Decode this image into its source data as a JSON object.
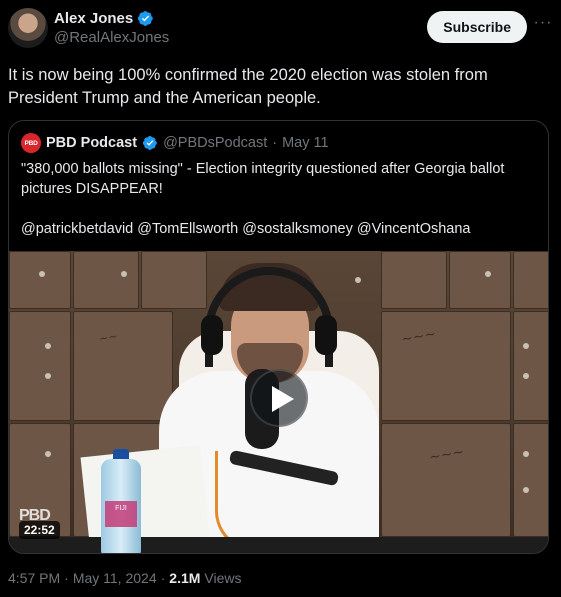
{
  "author": {
    "display_name": "Alex Jones",
    "handle": "@RealAlexJones",
    "verified_icon": "verified-badge-icon",
    "accent_color": "#1d9bf0"
  },
  "actions": {
    "subscribe_label": "Subscribe",
    "more_label": "···"
  },
  "tweet": {
    "text": "It is now being 100% confirmed the 2020 election was stolen from President Trump and the American people."
  },
  "quote": {
    "avatar_text": "PBD",
    "display_name": "PBD Podcast",
    "handle": "@PBDsPodcast",
    "separator": "·",
    "date": "May 11",
    "text_line1": "\"380,000 ballots missing\" - Election integrity questioned after Georgia ballot pictures DISAPPEAR!",
    "text_line2": "@patrickbetdavid @TomEllsworth @sostalksmoney @VincentOshana",
    "media": {
      "duration": "22:52",
      "watermark": "PBD",
      "bottle_label": "FIJI"
    }
  },
  "meta": {
    "time": "4:57 PM",
    "separator": "·",
    "date": "May 11, 2024",
    "separator2": "·",
    "views_count": "2.1M",
    "views_label": "Views"
  }
}
